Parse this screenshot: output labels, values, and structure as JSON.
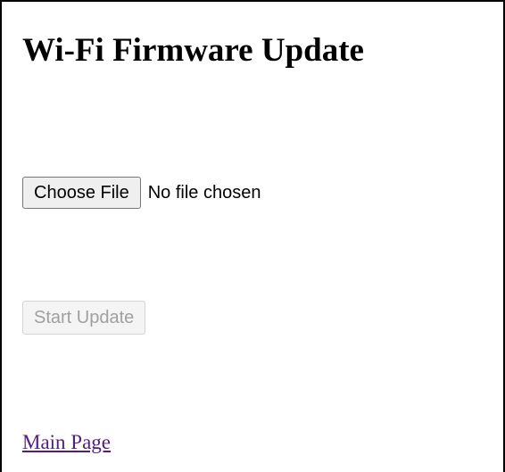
{
  "page": {
    "title": "Wi-Fi Firmware Update"
  },
  "file_input": {
    "button_label": "Choose File",
    "status": "No file chosen"
  },
  "actions": {
    "start_update_label": "Start Update",
    "start_update_enabled": false
  },
  "nav": {
    "main_page_link": "Main Page"
  },
  "colors": {
    "link_visited": "#551a8b",
    "disabled_text": "#a0a0a0",
    "button_background": "#efefef"
  }
}
